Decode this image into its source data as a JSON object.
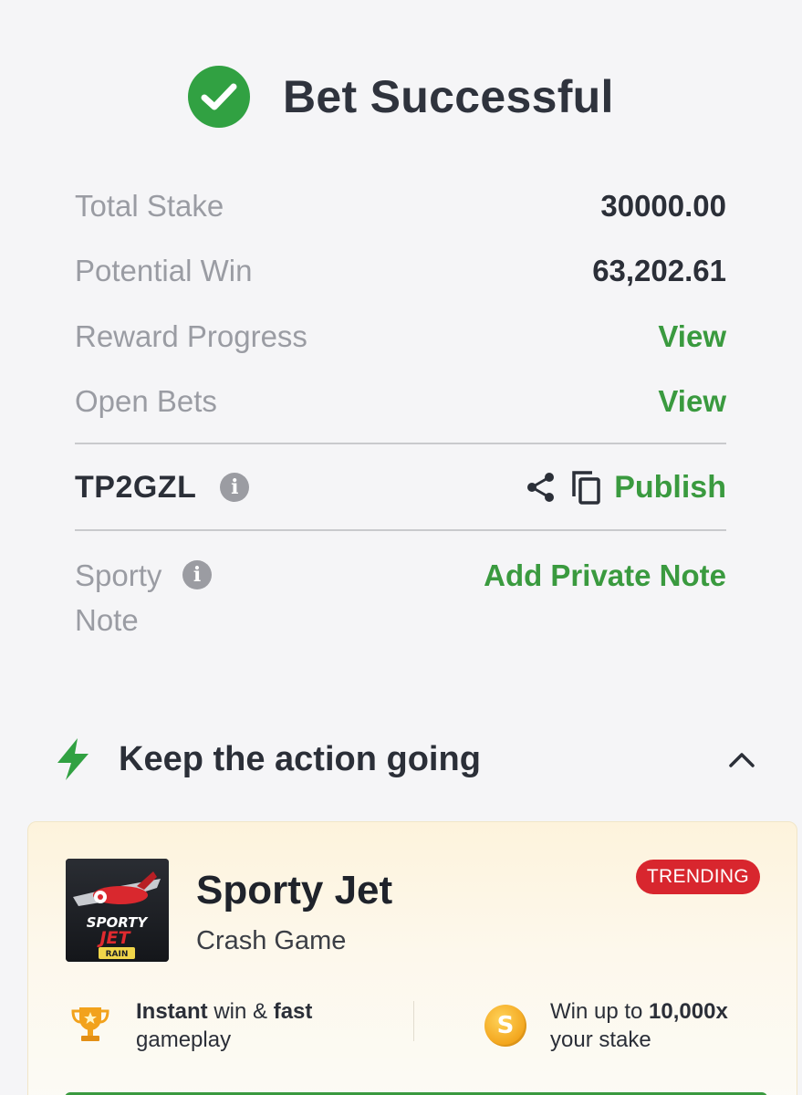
{
  "header": {
    "title": "Bet Successful"
  },
  "summary": {
    "rows": [
      {
        "label": "Total Stake",
        "value": "30000.00"
      },
      {
        "label": "Potential Win",
        "value": "63,202.61"
      },
      {
        "label": "Reward Progress",
        "link": "View"
      },
      {
        "label": "Open Bets",
        "link": "View"
      }
    ]
  },
  "booking": {
    "code": "TP2GZL",
    "info_glyph": "i",
    "publish_label": "Publish"
  },
  "note": {
    "label": "Sporty Note",
    "info_glyph": "i",
    "add_label": "Add Private Note"
  },
  "action": {
    "title": "Keep the action going"
  },
  "game": {
    "name": "Sporty Jet",
    "type": "Crash Game",
    "badge": "TRENDING",
    "thumb_text_top": "SPORTY",
    "thumb_text_bottom": "JET",
    "thumb_tag": "RAIN",
    "feature_1": {
      "bold_1": "Instant",
      "text_1": " win & ",
      "bold_2": "fast",
      "line_2": "gameplay"
    },
    "feature_2": {
      "text_1": "Win up to ",
      "bold_1": "10,000x",
      "line_2": "your stake",
      "coin_glyph": "S"
    }
  },
  "colors": {
    "accent": "#3a9a3f",
    "success": "#31a142",
    "badge": "#d8262e"
  }
}
